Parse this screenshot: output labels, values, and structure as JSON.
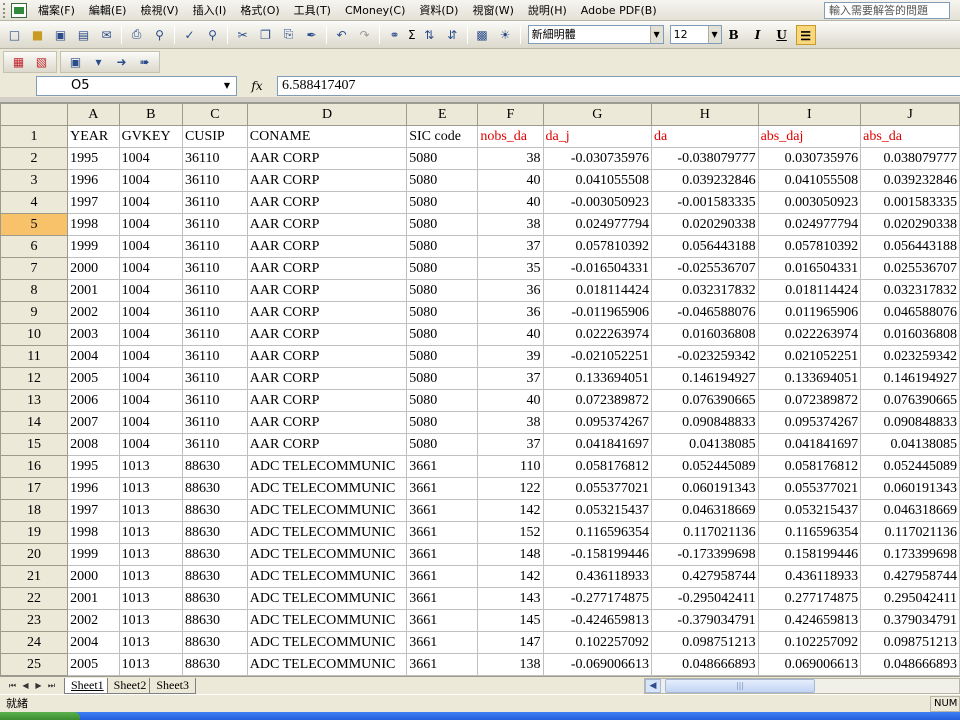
{
  "menu": {
    "items": [
      "檔案(F)",
      "編輯(E)",
      "檢視(V)",
      "插入(I)",
      "格式(O)",
      "工具(T)",
      "CMoney(C)",
      "資料(D)",
      "視窗(W)",
      "說明(H)",
      "Adobe PDF(B)"
    ],
    "ask_placeholder": "輸入需要解答的問題"
  },
  "toolbar": {
    "font_name": "新細明體",
    "font_size": "12",
    "bold": "B",
    "italic": "I",
    "underline": "U",
    "sigma": "Σ"
  },
  "formula_bar": {
    "cell_ref": "O5",
    "fx": "fx",
    "value": "6.588417407"
  },
  "grid": {
    "columns": [
      "A",
      "B",
      "C",
      "D",
      "E",
      "F",
      "G",
      "H",
      "I",
      "J"
    ],
    "header_row": [
      "YEAR",
      "GVKEY",
      "CUSIP",
      "CONAME",
      "SIC code",
      "nobs_da",
      "da_j",
      "da",
      "abs_daj",
      "abs_da"
    ],
    "selected_row": 5,
    "rows": [
      [
        "1995",
        "1004",
        "36110",
        "AAR CORP",
        "5080",
        "38",
        "-0.030735976",
        "-0.038079777",
        "0.030735976",
        "0.038079777"
      ],
      [
        "1996",
        "1004",
        "36110",
        "AAR CORP",
        "5080",
        "40",
        "0.041055508",
        "0.039232846",
        "0.041055508",
        "0.039232846"
      ],
      [
        "1997",
        "1004",
        "36110",
        "AAR CORP",
        "5080",
        "40",
        "-0.003050923",
        "-0.001583335",
        "0.003050923",
        "0.001583335"
      ],
      [
        "1998",
        "1004",
        "36110",
        "AAR CORP",
        "5080",
        "38",
        "0.024977794",
        "0.020290338",
        "0.024977794",
        "0.020290338"
      ],
      [
        "1999",
        "1004",
        "36110",
        "AAR CORP",
        "5080",
        "37",
        "0.057810392",
        "0.056443188",
        "0.057810392",
        "0.056443188"
      ],
      [
        "2000",
        "1004",
        "36110",
        "AAR CORP",
        "5080",
        "35",
        "-0.016504331",
        "-0.025536707",
        "0.016504331",
        "0.025536707"
      ],
      [
        "2001",
        "1004",
        "36110",
        "AAR CORP",
        "5080",
        "36",
        "0.018114424",
        "0.032317832",
        "0.018114424",
        "0.032317832"
      ],
      [
        "2002",
        "1004",
        "36110",
        "AAR CORP",
        "5080",
        "36",
        "-0.011965906",
        "-0.046588076",
        "0.011965906",
        "0.046588076"
      ],
      [
        "2003",
        "1004",
        "36110",
        "AAR CORP",
        "5080",
        "40",
        "0.022263974",
        "0.016036808",
        "0.022263974",
        "0.016036808"
      ],
      [
        "2004",
        "1004",
        "36110",
        "AAR CORP",
        "5080",
        "39",
        "-0.021052251",
        "-0.023259342",
        "0.021052251",
        "0.023259342"
      ],
      [
        "2005",
        "1004",
        "36110",
        "AAR CORP",
        "5080",
        "37",
        "0.133694051",
        "0.146194927",
        "0.133694051",
        "0.146194927"
      ],
      [
        "2006",
        "1004",
        "36110",
        "AAR CORP",
        "5080",
        "40",
        "0.072389872",
        "0.076390665",
        "0.072389872",
        "0.076390665"
      ],
      [
        "2007",
        "1004",
        "36110",
        "AAR CORP",
        "5080",
        "38",
        "0.095374267",
        "0.090848833",
        "0.095374267",
        "0.090848833"
      ],
      [
        "2008",
        "1004",
        "36110",
        "AAR CORP",
        "5080",
        "37",
        "0.041841697",
        "0.04138085",
        "0.041841697",
        "0.04138085"
      ],
      [
        "1995",
        "1013",
        "88630",
        "ADC TELECOMMUNIC",
        "3661",
        "110",
        "0.058176812",
        "0.052445089",
        "0.058176812",
        "0.052445089"
      ],
      [
        "1996",
        "1013",
        "88630",
        "ADC TELECOMMUNIC",
        "3661",
        "122",
        "0.055377021",
        "0.060191343",
        "0.055377021",
        "0.060191343"
      ],
      [
        "1997",
        "1013",
        "88630",
        "ADC TELECOMMUNIC",
        "3661",
        "142",
        "0.053215437",
        "0.046318669",
        "0.053215437",
        "0.046318669"
      ],
      [
        "1998",
        "1013",
        "88630",
        "ADC TELECOMMUNIC",
        "3661",
        "152",
        "0.116596354",
        "0.117021136",
        "0.116596354",
        "0.117021136"
      ],
      [
        "1999",
        "1013",
        "88630",
        "ADC TELECOMMUNIC",
        "3661",
        "148",
        "-0.158199446",
        "-0.173399698",
        "0.158199446",
        "0.173399698"
      ],
      [
        "2000",
        "1013",
        "88630",
        "ADC TELECOMMUNIC",
        "3661",
        "142",
        "0.436118933",
        "0.427958744",
        "0.436118933",
        "0.427958744"
      ],
      [
        "2001",
        "1013",
        "88630",
        "ADC TELECOMMUNIC",
        "3661",
        "143",
        "-0.277174875",
        "-0.295042411",
        "0.277174875",
        "0.295042411"
      ],
      [
        "2002",
        "1013",
        "88630",
        "ADC TELECOMMUNIC",
        "3661",
        "145",
        "-0.424659813",
        "-0.379034791",
        "0.424659813",
        "0.379034791"
      ],
      [
        "2004",
        "1013",
        "88630",
        "ADC TELECOMMUNIC",
        "3661",
        "147",
        "0.102257092",
        "0.098751213",
        "0.102257092",
        "0.098751213"
      ],
      [
        "2005",
        "1013",
        "88630",
        "ADC TELECOMMUNIC",
        "3661",
        "138",
        "-0.069006613",
        "0.048666893",
        "0.069006613",
        "0.048666893"
      ]
    ]
  },
  "sheets": {
    "tabs": [
      "Sheet1",
      "Sheet2",
      "Sheet3"
    ],
    "active": "Sheet1"
  },
  "status": {
    "ready": "就緒",
    "num_lock": "NUM"
  },
  "colors": {
    "header_red": "#e00000",
    "selected_row_header": "#f8c26a"
  }
}
